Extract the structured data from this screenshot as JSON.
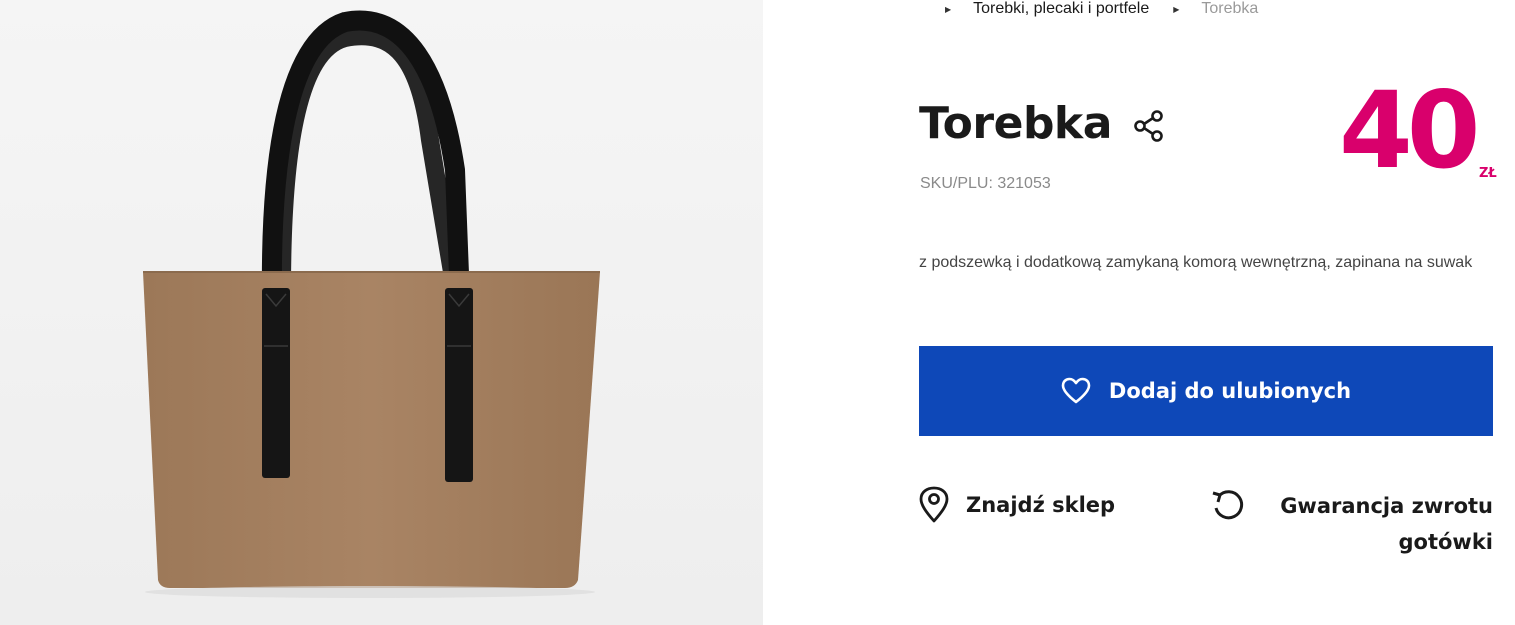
{
  "breadcrumb": {
    "items": [
      {
        "label": "Torebki, plecaki i portfele"
      },
      {
        "label": "Torebka"
      }
    ]
  },
  "product": {
    "title": "Torebka",
    "sku": "SKU/PLU: 321053",
    "price": "40",
    "currency": "ZŁ",
    "description": "z podszewką i dodatkową zamykaną komorą wewnętrzną, zapinana na suwak",
    "image_alt_icon": "bag-photo"
  },
  "actions": {
    "favorite_label": "Dodaj do ulubionych",
    "find_store_label": "Znajdź sklep",
    "refund_label": "Gwarancja zwrotu gotówki"
  },
  "icons": {
    "share": "share-icon",
    "favorite": "heart-icon",
    "store": "map-pin-icon",
    "refund": "refresh-icon"
  },
  "colors": {
    "price": "#d9006c",
    "button": "#0e48b8",
    "bag_body": "#a27e5f",
    "bag_handles": "#1c1c1c"
  }
}
